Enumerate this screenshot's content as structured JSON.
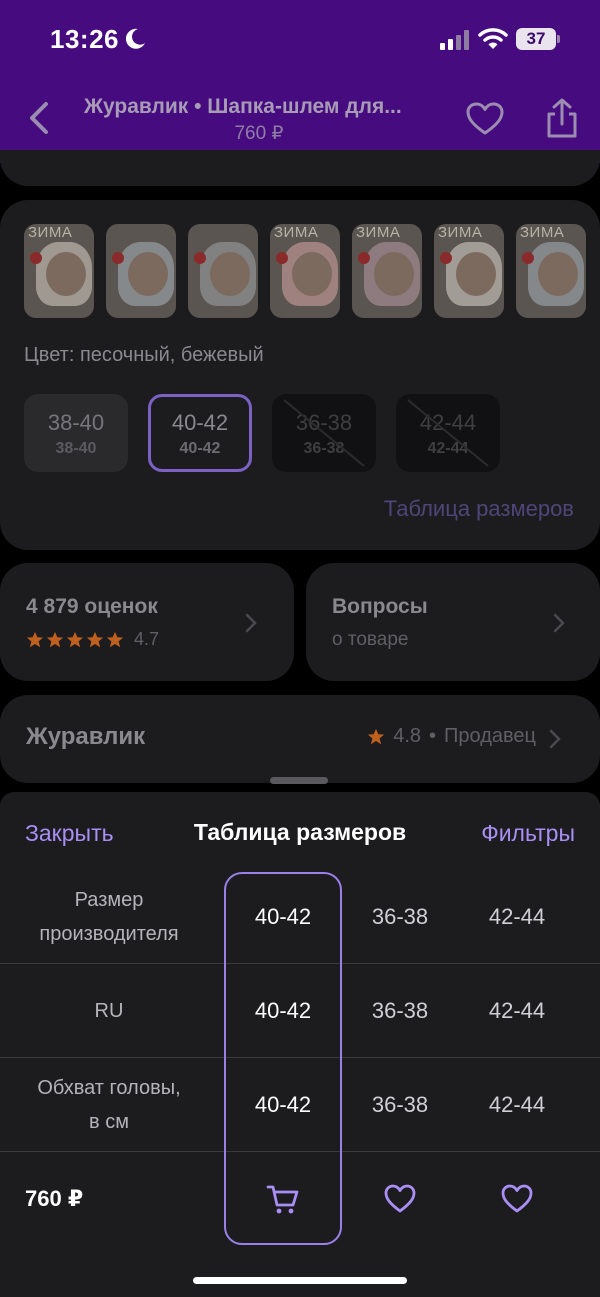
{
  "status_bar": {
    "time": "13:26",
    "battery": "37"
  },
  "header": {
    "title": "Журавлик • Шапка-шлем для...",
    "price": "760 ₽"
  },
  "gallery": {
    "thumbnails": [
      {
        "caption": "ЗИМА",
        "hood_color": "#d9d2c6"
      },
      {
        "caption": "",
        "hood_color": "#a9b4bd"
      },
      {
        "caption": "",
        "hood_color": "#a2a6ab"
      },
      {
        "caption": "ЗИМА",
        "hood_color": "#d9a8a8"
      },
      {
        "caption": "ЗИМА",
        "hood_color": "#b99aa6"
      },
      {
        "caption": "ЗИМА",
        "hood_color": "#ddd8cf"
      },
      {
        "caption": "ЗИМА",
        "hood_color": "#aab2bb"
      }
    ]
  },
  "color": {
    "label": "Цвет:",
    "value": "песочный, бежевый"
  },
  "sizes": [
    {
      "main": "38-40",
      "sub": "38-40",
      "state": "available"
    },
    {
      "main": "40-42",
      "sub": "40-42",
      "state": "selected"
    },
    {
      "main": "36-38",
      "sub": "36-38",
      "state": "unavailable"
    },
    {
      "main": "42-44",
      "sub": "42-44",
      "state": "unavailable"
    }
  ],
  "size_table_link": "Таблица размеров",
  "rating_card": {
    "title": "4 879 оценок",
    "rating": "4.7",
    "stars": 5
  },
  "questions_card": {
    "title": "Вопросы",
    "subtitle": "о товаре"
  },
  "seller_card": {
    "name": "Журавлик",
    "rating": "4.8",
    "separator": "•",
    "role": "Продавец"
  },
  "sheet": {
    "close_label": "Закрыть",
    "title": "Таблица размеров",
    "filters_label": "Фильтры",
    "rows": [
      {
        "label": "Размер производителя",
        "values": [
          "40-42",
          "36-38",
          "42-44"
        ]
      },
      {
        "label": "RU",
        "values": [
          "40-42",
          "36-38",
          "42-44"
        ]
      },
      {
        "label": "Обхват головы, в см",
        "values": [
          "40-42",
          "36-38",
          "42-44"
        ]
      }
    ],
    "footer_price": "760 ₽"
  },
  "colors": {
    "header_purple": "#460b7f",
    "accent": "#a98ef5",
    "star": "#c0601e"
  }
}
